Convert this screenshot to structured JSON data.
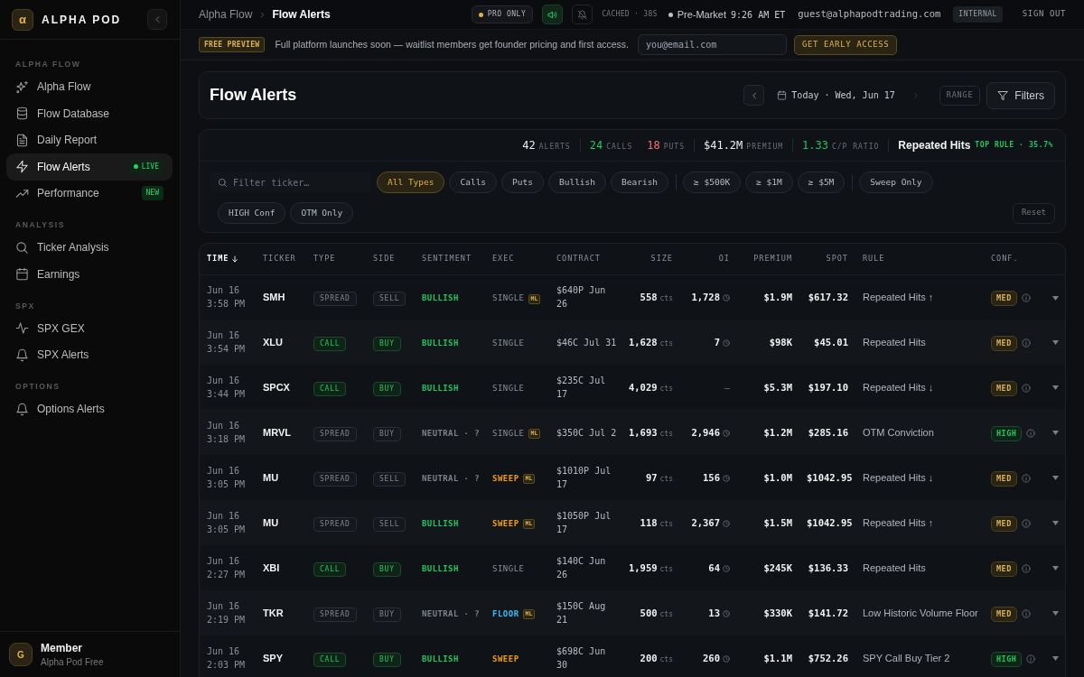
{
  "sidebar": {
    "logo_mark": "α",
    "brand": "ALPHA POD",
    "sections": [
      {
        "title": "ALPHA FLOW",
        "items": [
          {
            "label": "Alpha Flow",
            "selected": false
          },
          {
            "label": "Flow Database",
            "selected": false
          },
          {
            "label": "Daily Report",
            "selected": false
          },
          {
            "label": "Flow Alerts",
            "selected": true,
            "badge": {
              "text": "LIVE",
              "kind": "live"
            }
          },
          {
            "label": "Performance",
            "selected": false,
            "badge": {
              "text": "NEW",
              "kind": "new"
            }
          }
        ]
      },
      {
        "title": "ANALYSIS",
        "items": [
          {
            "label": "Ticker Analysis",
            "selected": false
          },
          {
            "label": "Earnings",
            "selected": false
          }
        ]
      },
      {
        "title": "SPX",
        "items": [
          {
            "label": "SPX GEX",
            "selected": false
          },
          {
            "label": "SPX Alerts",
            "selected": false
          }
        ]
      },
      {
        "title": "OPTIONS",
        "items": [
          {
            "label": "Options Alerts",
            "selected": false
          }
        ]
      }
    ],
    "user": {
      "initial": "G",
      "name": "Member",
      "plan": "Alpha Pod Free"
    }
  },
  "top_bar": {
    "breadcrumb": [
      "Alpha Flow",
      "Flow Alerts"
    ],
    "plan_pill": "PRO ONLY",
    "sound_on": true,
    "notifications_on": false,
    "cache_status": "CACHED · 38S",
    "market_session": "Pre-Market",
    "market_time": "9:26 AM ET",
    "user_email": "guest@alphapodtrading.com",
    "role_badge": "INTERNAL",
    "sign_out": "SIGN OUT"
  },
  "banner": {
    "badge": "FREE PREVIEW",
    "message": "Full platform launches soon — waitlist members get founder pricing and first access.",
    "email_field": {
      "placeholder": "you@email.com"
    },
    "button": "GET EARLY ACCESS"
  },
  "page_header": {
    "title": "Flow Alerts",
    "date_nav": {
      "prev": {
        "disabled": false
      },
      "label": "Today · Wed, Jun 17",
      "next": {
        "disabled": true
      }
    },
    "range_button": "RANGE",
    "filters_button": "Filters"
  },
  "stats": {
    "groups": [
      [
        {
          "value": "42",
          "label": "ALERTS",
          "color": "#ececec"
        }
      ],
      [
        {
          "value": "24",
          "label": "CALLS",
          "color": "#22c55e"
        },
        {
          "value": "18",
          "label": "PUTS",
          "color": "#f87171"
        }
      ],
      [
        {
          "value": "$41.2M",
          "label": "PREMIUM",
          "color": "#ececec"
        }
      ],
      [
        {
          "value": "1.33",
          "label": "C/P RATIO",
          "color": "#22c55e"
        }
      ]
    ],
    "top_rule": {
      "name": "Repeated Hits",
      "label": "TOP RULE · 35.7%"
    }
  },
  "filters": {
    "search": {
      "placeholder": "Filter ticker…"
    },
    "chip_rows": [
      [
        [
          {
            "label": "All Types",
            "selected": true
          },
          {
            "label": "Calls",
            "selected": false
          },
          {
            "label": "Puts",
            "selected": false
          },
          {
            "label": "Bullish",
            "selected": false
          },
          {
            "label": "Bearish",
            "selected": false
          }
        ],
        [
          {
            "label": "≥ $500K",
            "selected": false
          },
          {
            "label": "≥ $1M",
            "selected": false
          },
          {
            "label": "≥ $5M",
            "selected": false
          }
        ],
        [
          {
            "label": "Sweep Only",
            "selected": false
          }
        ]
      ],
      [
        [
          {
            "label": "HIGH Conf",
            "selected": false
          },
          {
            "label": "OTM Only",
            "selected": false
          }
        ]
      ]
    ],
    "reset": "Reset"
  },
  "table": {
    "columns": [
      {
        "label": "TIME",
        "sorted": true
      },
      {
        "label": "TICKER",
        "sorted": false
      },
      {
        "label": "TYPE",
        "sorted": false
      },
      {
        "label": "SIDE",
        "sorted": false
      },
      {
        "label": "SENTIMENT",
        "sorted": false
      },
      {
        "label": "EXEC",
        "sorted": false
      },
      {
        "label": "CONTRACT",
        "sorted": false
      },
      {
        "label": "SIZE",
        "sorted": false
      },
      {
        "label": "OI",
        "sorted": false
      },
      {
        "label": "PREMIUM",
        "sorted": false
      },
      {
        "label": "SPOT",
        "sorted": false
      },
      {
        "label": "RULE",
        "sorted": false
      },
      {
        "label": "CONF.",
        "sorted": false
      }
    ],
    "rows": [
      {
        "date": "Jun 16",
        "time": "3:58 PM",
        "ticker": "SMH",
        "type": {
          "text": "SPREAD",
          "kind": "spread"
        },
        "side": {
          "text": "SELL",
          "highlighted": false
        },
        "sentiment": {
          "text": "BULLISH",
          "kind": "bullish"
        },
        "exec": {
          "text": "SINGLE",
          "kind": "single",
          "tag": "ML"
        },
        "contract": "$640P Jun 26",
        "size": "558",
        "size_unit": "cts",
        "oi": "1,728",
        "oi_icon": true,
        "premium": "$1.9M",
        "spot": "$617.32",
        "rule": "Repeated Hits ↑",
        "conf": {
          "text": "MED",
          "kind": "med"
        }
      },
      {
        "date": "Jun 16",
        "time": "3:54 PM",
        "ticker": "XLU",
        "type": {
          "text": "CALL",
          "kind": "call"
        },
        "side": {
          "text": "BUY",
          "highlighted": true
        },
        "sentiment": {
          "text": "BULLISH",
          "kind": "bullish"
        },
        "exec": {
          "text": "SINGLE",
          "kind": "single"
        },
        "contract": "$46C Jul 31",
        "size": "1,628",
        "size_unit": "cts",
        "oi": "7",
        "oi_icon": true,
        "premium": "$98K",
        "spot": "$45.01",
        "rule": "Repeated Hits",
        "conf": {
          "text": "MED",
          "kind": "med"
        }
      },
      {
        "date": "Jun 16",
        "time": "3:44 PM",
        "ticker": "SPCX",
        "type": {
          "text": "CALL",
          "kind": "call"
        },
        "side": {
          "text": "BUY",
          "highlighted": true
        },
        "sentiment": {
          "text": "BULLISH",
          "kind": "bullish"
        },
        "exec": {
          "text": "SINGLE",
          "kind": "single"
        },
        "contract": "$235C Jul 17",
        "size": "4,029",
        "size_unit": "cts",
        "oi": "—",
        "oi_icon": false,
        "premium": "$5.3M",
        "spot": "$197.10",
        "rule": "Repeated Hits ↓",
        "conf": {
          "text": "MED",
          "kind": "med"
        }
      },
      {
        "date": "Jun 16",
        "time": "3:18 PM",
        "ticker": "MRVL",
        "type": {
          "text": "SPREAD",
          "kind": "spread"
        },
        "side": {
          "text": "BUY",
          "highlighted": false
        },
        "sentiment": {
          "text": "NEUTRAL · ?",
          "kind": "neutral"
        },
        "exec": {
          "text": "SINGLE",
          "kind": "single",
          "tag": "ML"
        },
        "contract": "$350C Jul 2",
        "size": "1,693",
        "size_unit": "cts",
        "oi": "2,946",
        "oi_icon": true,
        "premium": "$1.2M",
        "spot": "$285.16",
        "rule": "OTM Conviction",
        "conf": {
          "text": "HIGH",
          "kind": "high"
        }
      },
      {
        "date": "Jun 16",
        "time": "3:05 PM",
        "ticker": "MU",
        "type": {
          "text": "SPREAD",
          "kind": "spread"
        },
        "side": {
          "text": "SELL",
          "highlighted": false
        },
        "sentiment": {
          "text": "NEUTRAL · ?",
          "kind": "neutral"
        },
        "exec": {
          "text": "SWEEP",
          "kind": "sweep",
          "tag": "ML"
        },
        "contract": "$1010P Jul 17",
        "size": "97",
        "size_unit": "cts",
        "oi": "156",
        "oi_icon": true,
        "premium": "$1.0M",
        "spot": "$1042.95",
        "rule": "Repeated Hits ↓",
        "conf": {
          "text": "MED",
          "kind": "med"
        }
      },
      {
        "date": "Jun 16",
        "time": "3:05 PM",
        "ticker": "MU",
        "type": {
          "text": "SPREAD",
          "kind": "spread"
        },
        "side": {
          "text": "SELL",
          "highlighted": false
        },
        "sentiment": {
          "text": "BULLISH",
          "kind": "bullish"
        },
        "exec": {
          "text": "SWEEP",
          "kind": "sweep",
          "tag": "ML"
        },
        "contract": "$1050P Jul 17",
        "size": "118",
        "size_unit": "cts",
        "oi": "2,367",
        "oi_icon": true,
        "premium": "$1.5M",
        "spot": "$1042.95",
        "rule": "Repeated Hits ↑",
        "conf": {
          "text": "MED",
          "kind": "med"
        }
      },
      {
        "date": "Jun 16",
        "time": "2:27 PM",
        "ticker": "XBI",
        "type": {
          "text": "CALL",
          "kind": "call"
        },
        "side": {
          "text": "BUY",
          "highlighted": true
        },
        "sentiment": {
          "text": "BULLISH",
          "kind": "bullish"
        },
        "exec": {
          "text": "SINGLE",
          "kind": "single"
        },
        "contract": "$140C Jun 26",
        "size": "1,959",
        "size_unit": "cts",
        "oi": "64",
        "oi_icon": true,
        "premium": "$245K",
        "spot": "$136.33",
        "rule": "Repeated Hits",
        "conf": {
          "text": "MED",
          "kind": "med"
        }
      },
      {
        "date": "Jun 16",
        "time": "2:19 PM",
        "ticker": "TKR",
        "type": {
          "text": "SPREAD",
          "kind": "spread"
        },
        "side": {
          "text": "BUY",
          "highlighted": false
        },
        "sentiment": {
          "text": "NEUTRAL · ?",
          "kind": "neutral"
        },
        "exec": {
          "text": "FLOOR",
          "kind": "floor",
          "tag": "ML"
        },
        "contract": "$150C Aug 21",
        "size": "500",
        "size_unit": "cts",
        "oi": "13",
        "oi_icon": true,
        "premium": "$330K",
        "spot": "$141.72",
        "rule": "Low Historic Volume Floor",
        "conf": {
          "text": "MED",
          "kind": "med"
        }
      },
      {
        "date": "Jun 16",
        "time": "2:03 PM",
        "ticker": "SPY",
        "type": {
          "text": "CALL",
          "kind": "call"
        },
        "side": {
          "text": "BUY",
          "highlighted": true
        },
        "sentiment": {
          "text": "BULLISH",
          "kind": "bullish"
        },
        "exec": {
          "text": "SWEEP",
          "kind": "sweep"
        },
        "contract": "$698C Jun 30",
        "size": "200",
        "size_unit": "cts",
        "oi": "260",
        "oi_icon": true,
        "premium": "$1.1M",
        "spot": "$752.26",
        "rule": "SPY Call Buy Tier 2",
        "conf": {
          "text": "HIGH",
          "kind": "high"
        }
      }
    ]
  }
}
